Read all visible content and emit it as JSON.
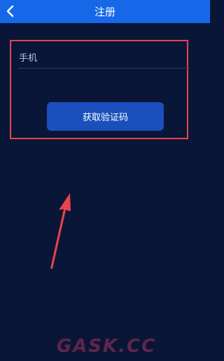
{
  "header": {
    "title": "注册",
    "back_icon": "chevron-left-icon",
    "background": "#1668e8"
  },
  "form": {
    "phone_placeholder": "手机",
    "phone_value": "",
    "get_code_label": "获取验证码"
  },
  "annotation": {
    "highlight_color": "#e8434f",
    "arrow_color": "#e8434f"
  },
  "watermark": {
    "text": "GASK.CC"
  }
}
